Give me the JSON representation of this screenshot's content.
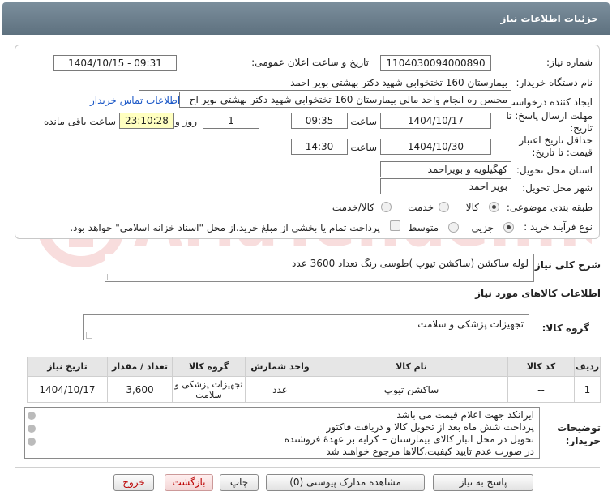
{
  "header": {
    "title": "جزئیات اطلاعات نیاز"
  },
  "form": {
    "need_number_label": "شماره نیاز:",
    "need_number": "1104030094000890",
    "announce_label": "تاریخ و ساعت اعلان عمومی:",
    "announce_value": "1404/10/15 - 09:31",
    "buyer_label": "نام دستگاه خریدار:",
    "buyer_value": "بیمارستان 160 تختخوابی شهید دکتر بهشتی بویر احمد",
    "creator_label": "ایجاد کننده درخواست:",
    "creator_value": "محسن ره انجام واحد مالی بیمارستان 160 تختخوابی شهید دکتر بهشتی بویر اح",
    "contact_link": "اطلاعات تماس خریدار",
    "deadline_label": "مهلت ارسال پاسخ: تا تاریخ:",
    "deadline_date": "1404/10/17",
    "time_label": "ساعت",
    "deadline_time": "09:35",
    "days_value": "1",
    "days_label": "روز و",
    "remaining_time": "23:10:28",
    "remaining_label": "ساعت باقی مانده",
    "validity_label": "حداقل تاریخ اعتبار قیمت: تا تاریخ:",
    "validity_date": "1404/10/30",
    "validity_time": "14:30",
    "province_label": "استان محل تحویل:",
    "province_value": "کهگیلویه و بویراحمد",
    "city_label": "شهر محل تحویل:",
    "city_value": "بویر احمد",
    "category_label": "طبقه بندی موضوعی:",
    "category_options": [
      "کالا",
      "خدمت",
      "کالا/خدمت"
    ],
    "process_label": "نوع فرآیند خرید :",
    "process_options": [
      "جزیی",
      "متوسط"
    ],
    "payment_note": "پرداخت تمام یا بخشی از مبلغ خرید،از محل \"اسناد خزانه اسلامی\" خواهد بود."
  },
  "summary": {
    "label": "شرح کلی نیاز:",
    "value": "لوله ساکشن (ساکشن تیوپ )طوسی رنگ تعداد 3600 عدد"
  },
  "goods_section": {
    "title": "اطلاعات کالاهای مورد نیاز"
  },
  "group": {
    "label": "گروه کالا:",
    "value": "تجهیزات پزشکی و سلامت"
  },
  "table": {
    "headers": [
      "ردیف",
      "کد کالا",
      "نام کالا",
      "واحد شمارش",
      "گروه کالا",
      "تعداد / مقدار",
      "تاریخ نیاز"
    ],
    "rows": [
      [
        "1",
        "--",
        "ساکشن تیوپ",
        "عدد",
        "تجهیزات پزشکی و سلامت",
        "3,600",
        "1404/10/17"
      ]
    ]
  },
  "notes": {
    "label": "توضیحات خریدار:",
    "lines": [
      "ایرانکد جهت اعلام قیمت می باشد",
      "پرداخت شش ماه بعد از تحویل کالا و دریافت فاکتور",
      "تحویل در محل انبار کالای بیمارستان – کرایه بر عهدهٔ فروشنده",
      "در صورت عدم تایید کیفیت،کالاها مرجوع خواهند شد"
    ]
  },
  "buttons": {
    "reply": "پاسخ به نیاز",
    "attachments": "مشاهده مدارک پیوستی (0)",
    "print": "چاپ",
    "back": "بازگشت",
    "exit": "خروج"
  },
  "watermark": "AriaTender.neT"
}
